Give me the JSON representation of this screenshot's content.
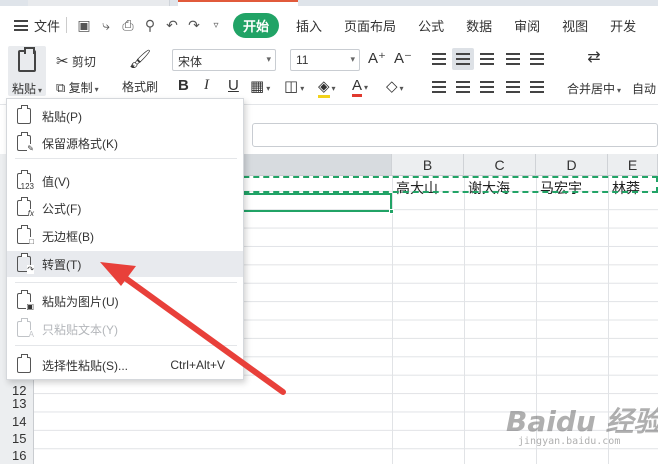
{
  "menubar": {
    "file_label": "文件",
    "tabs": [
      {
        "label": "开始",
        "active": true
      },
      {
        "label": "插入"
      },
      {
        "label": "页面布局"
      },
      {
        "label": "公式"
      },
      {
        "label": "数据"
      },
      {
        "label": "审阅"
      },
      {
        "label": "视图"
      },
      {
        "label": "开发"
      }
    ]
  },
  "ribbon": {
    "paste_label": "粘贴",
    "cut_label": "剪切",
    "copy_label": "复制",
    "format_painter_label": "格式刷",
    "font_name": "宋体",
    "font_size": "11",
    "bold": "B",
    "italic": "I",
    "underline": "U",
    "grow_font": "A⁺",
    "shrink_font": "A⁻",
    "merge_center_label": "合并居中",
    "auto_wrap_label": "自动"
  },
  "columns": [
    "B",
    "C",
    "D",
    "E"
  ],
  "row_numbers": [
    "12",
    "13",
    "14",
    "15",
    "16"
  ],
  "cells": [
    "高大山",
    "谢大海",
    "马宏宇",
    "林莽"
  ],
  "paste_menu": {
    "items": [
      {
        "label": "粘贴(P)",
        "icon": "paste-icon"
      },
      {
        "label": "保留源格式(K)",
        "icon": "keep-format-icon"
      },
      {
        "label": "值(V)",
        "icon": "paste-values-icon",
        "badge": "123"
      },
      {
        "label": "公式(F)",
        "icon": "paste-formula-icon",
        "badge": "fx"
      },
      {
        "label": "无边框(B)",
        "icon": "no-border-icon"
      },
      {
        "label": "转置(T)",
        "icon": "transpose-icon",
        "hover": true
      },
      {
        "label": "粘贴为图片(U)",
        "icon": "paste-picture-icon"
      },
      {
        "label": "只粘贴文本(Y)",
        "icon": "paste-text-icon",
        "disabled": true
      },
      {
        "label": "选择性粘贴(S)...",
        "icon": "paste-special-icon",
        "shortcut": "Ctrl+Alt+V"
      }
    ]
  },
  "watermark": {
    "main": "Baidu 经验",
    "sub": "jingyan.baidu.com"
  },
  "colors": {
    "accent": "#21a366",
    "arrow": "#e8403a"
  }
}
